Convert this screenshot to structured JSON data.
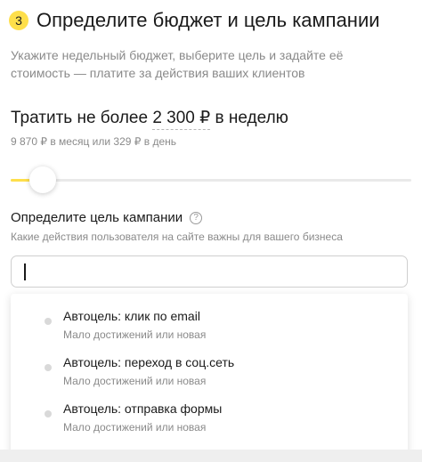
{
  "header": {
    "step_number": "3",
    "title": "Определите бюджет и цель кампании"
  },
  "subtitle": "Укажите недельный бюджет, выберите цель и задайте её стоимость — платите за действия ваших клиентов",
  "budget": {
    "prefix": "Тратить не более",
    "amount": "2 300 ₽",
    "suffix": "в неделю",
    "sub": "9 870 ₽ в месяц или 329 ₽ в день",
    "slider_fraction": 0.08
  },
  "goal": {
    "label": "Определите цель кампании",
    "help_icon": "question-circle-icon",
    "help_glyph": "?",
    "description": "Какие действия пользователя на сайте важны для вашего бизнеса",
    "input_value": "",
    "options": [
      {
        "title": "Автоцель: клик по email",
        "subtitle": "Мало достижений или новая"
      },
      {
        "title": "Автоцель: переход в соц.сеть",
        "subtitle": "Мало достижений или новая"
      },
      {
        "title": "Автоцель: отправка формы",
        "subtitle": "Мало достижений или новая"
      }
    ]
  },
  "colors": {
    "accent": "#fedf4b",
    "text_primary": "#1a1a1a",
    "text_secondary": "#8a8a8a",
    "option_dot": "#d9d9d9"
  }
}
